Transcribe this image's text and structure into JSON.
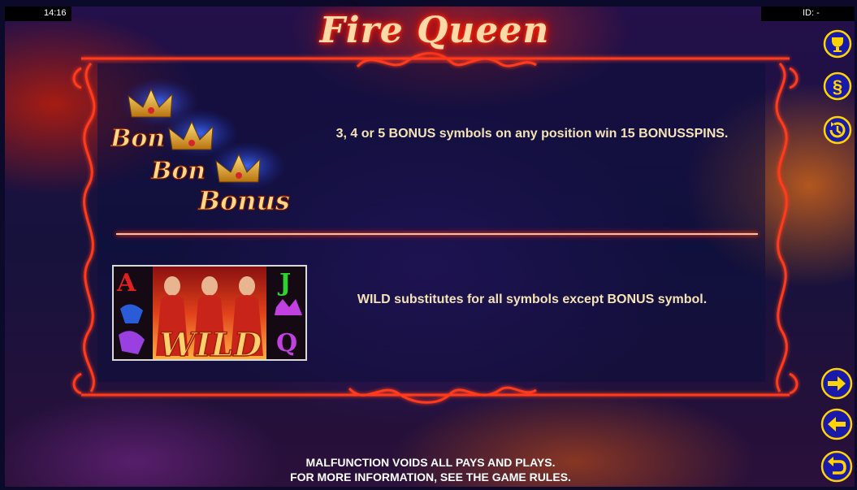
{
  "status": {
    "time": "14:16",
    "id_label": "ID: -"
  },
  "title": "Fire Queen",
  "rules": [
    {
      "symbol": "Bonus",
      "text": "3, 4 or 5 BONUS symbols on any position win 15 BONUSSPINS."
    },
    {
      "symbol": "Wild",
      "text": "WILD substitutes for all symbols except BONUS symbol."
    }
  ],
  "symbols": {
    "bonus_word": "Bonus",
    "wild_word": "WILD",
    "card_a": "A",
    "card_j": "J",
    "card_q": "Q"
  },
  "nav": {
    "trophy": "trophy-icon",
    "paragraph": "§",
    "history": "history-icon",
    "next": "arrow-right-icon",
    "prev": "arrow-left-icon",
    "back": "return-icon"
  },
  "footer": {
    "line1": "MALFUNCTION VOIDS ALL PAYS AND PLAYS.",
    "line2": "FOR MORE INFORMATION, SEE THE GAME RULES."
  },
  "colors": {
    "frame": "#ff3a1a",
    "button": "#1a1aa8",
    "button_icon": "#ffd400",
    "text": "#f4e3b6"
  }
}
